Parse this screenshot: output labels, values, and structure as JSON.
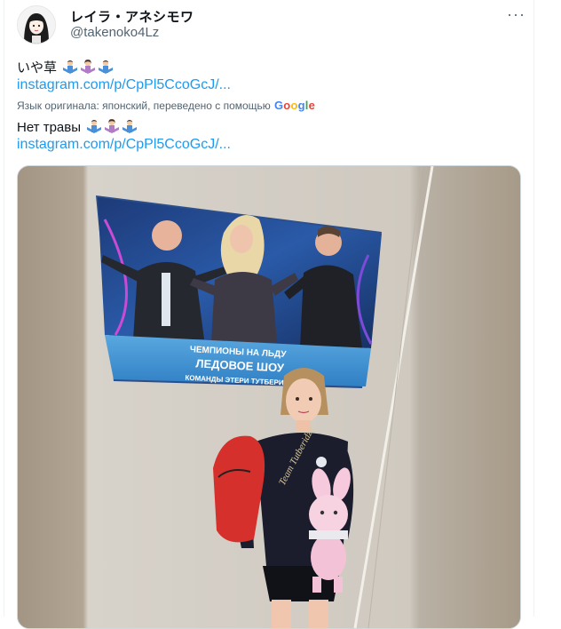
{
  "tweet": {
    "display_name": "レイラ・アネシモワ",
    "handle": "@takenoko4Lz",
    "original_text": "いや草",
    "link_text": "instagram.com/p/CpPl5CcoGcJ/...",
    "translation_note": "Язык оригинала: японский, переведено с помощью",
    "translation_provider": "Google",
    "translated_text": "Нет травы",
    "more_label": "···"
  },
  "colors": {
    "link": "#1d9bf0",
    "secondary_text": "#536471",
    "google_blue": "#4285F4",
    "google_red": "#EA4335",
    "google_yellow": "#FBBC05",
    "google_green": "#34A853"
  },
  "icons": {
    "more": "more-horizontal-icon",
    "emoji_sequence": [
      "person-gesturing-no-man-emoji",
      "person-gesturing-no-woman-emoji",
      "person-gesturing-no-man-emoji"
    ]
  },
  "media": {
    "poster_line1": "ЧЕМПИОНЫ НА ЛЬДУ",
    "poster_line2": "ЛЕДОВОЕ ШОУ",
    "poster_line3": "КОМАНДЫ ЭТЕРИ ТУТБЕРИДЗЕ",
    "shirt_text": "Team Tutberidze"
  }
}
